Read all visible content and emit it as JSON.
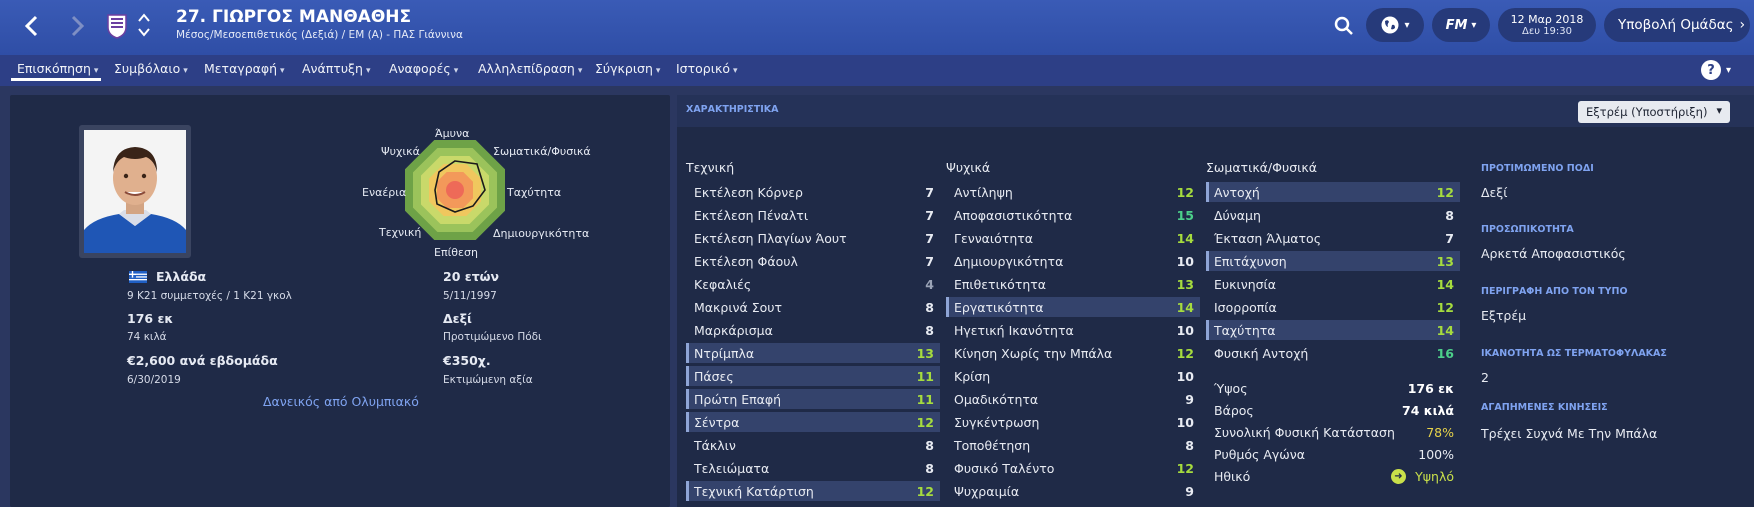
{
  "header": {
    "title": "27. ΓΙΩΡΓΟΣ ΜΑΝΘΑΘΗΣ",
    "subtitle": "Μέσος/Μεσοεπιθετικός (Δεξιά) / ΕΜ (Α) - ΠΑΣ Γιάννινα",
    "date": "12 Μαρ 2018",
    "time": "Δευ 19:30",
    "submit_label": "Υποβολή Ομάδας",
    "fm_label": "FM"
  },
  "nav": {
    "tabs": [
      "Επισκόπηση",
      "Συμβόλαιο",
      "Μεταγραφή",
      "Ανάπτυξη",
      "Αναφορές",
      "Αλληλεπίδραση",
      "Σύγκριση",
      "Ιστορικό"
    ]
  },
  "overview": {
    "nationality": "Ελλάδα",
    "caps": "9 K21 συμμετοχές / 1 K21 γκολ",
    "height": "176 εκ",
    "weight": "74 κιλά",
    "wage": "€2,600 ανά εβδομάδα",
    "contract_end": "6/30/2019",
    "age": "20 ετών",
    "dob": "5/11/1997",
    "foot": "Δεξί",
    "foot_label": "Προτιμώμενο Πόδι",
    "value": "€350χ.",
    "value_label": "Εκτιμώμενη αξία",
    "loan_note": "Δανεικός από Ολυμπιακό"
  },
  "radar": {
    "labels": {
      "defence": "Άμυνα",
      "physical": "Σωματικά/Φυσικά",
      "speed": "Ταχύτητα",
      "creativity": "Δημιουργικότητα",
      "attack": "Επίθεση",
      "technique": "Τεχνική",
      "aerial": "Εναέρια",
      "mental": "Ψυχικά"
    }
  },
  "attributes": {
    "section_title": "ΧΑΡΑΚΤΗΡΙΣΤΙΚΑ",
    "dropdown_label": "Εξτρέμ (Υποστήριξη)",
    "technical": {
      "title": "Τεχνική",
      "items": [
        {
          "name": "Εκτέλεση Κόρνερ",
          "value": "7",
          "color": "#e8ebf2",
          "hl": false
        },
        {
          "name": "Εκτέλεση Πέναλτι",
          "value": "7",
          "color": "#e8ebf2",
          "hl": false
        },
        {
          "name": "Εκτέλεση Πλαγίων Άουτ",
          "value": "7",
          "color": "#e8ebf2",
          "hl": false
        },
        {
          "name": "Εκτέλεση Φάουλ",
          "value": "7",
          "color": "#e8ebf2",
          "hl": false
        },
        {
          "name": "Κεφαλιές",
          "value": "4",
          "color": "#9aa3b6",
          "hl": false
        },
        {
          "name": "Μακρινά Σουτ",
          "value": "8",
          "color": "#e8ebf2",
          "hl": false
        },
        {
          "name": "Μαρκάρισμα",
          "value": "8",
          "color": "#e8ebf2",
          "hl": false
        },
        {
          "name": "Ντρίμπλα",
          "value": "13",
          "color": "#a6dc3e",
          "hl": true
        },
        {
          "name": "Πάσες",
          "value": "11",
          "color": "#a6dc3e",
          "hl": true
        },
        {
          "name": "Πρώτη Επαφή",
          "value": "11",
          "color": "#a6dc3e",
          "hl": true
        },
        {
          "name": "Σέντρα",
          "value": "12",
          "color": "#a6dc3e",
          "hl": true
        },
        {
          "name": "Τάκλιν",
          "value": "8",
          "color": "#e8ebf2",
          "hl": false
        },
        {
          "name": "Τελειώματα",
          "value": "8",
          "color": "#e8ebf2",
          "hl": false
        },
        {
          "name": "Τεχνική Κατάρτιση",
          "value": "12",
          "color": "#a6dc3e",
          "hl": true
        }
      ]
    },
    "mental": {
      "title": "Ψυχικά",
      "items": [
        {
          "name": "Αντίληψη",
          "value": "12",
          "color": "#a6dc3e",
          "hl": false
        },
        {
          "name": "Αποφασιστικότητα",
          "value": "15",
          "color": "#4cd08a",
          "hl": false
        },
        {
          "name": "Γενναιότητα",
          "value": "14",
          "color": "#a6dc3e",
          "hl": false
        },
        {
          "name": "Δημιουργικότητα",
          "value": "10",
          "color": "#e8ebf2",
          "hl": false
        },
        {
          "name": "Επιθετικότητα",
          "value": "13",
          "color": "#a6dc3e",
          "hl": false
        },
        {
          "name": "Εργατικότητα",
          "value": "14",
          "color": "#a6dc3e",
          "hl": true
        },
        {
          "name": "Ηγετική Ικανότητα",
          "value": "10",
          "color": "#e8ebf2",
          "hl": false
        },
        {
          "name": "Κίνηση Χωρίς την Μπάλα",
          "value": "12",
          "color": "#a6dc3e",
          "hl": false
        },
        {
          "name": "Κρίση",
          "value": "10",
          "color": "#e8ebf2",
          "hl": false
        },
        {
          "name": "Ομαδικότητα",
          "value": "9",
          "color": "#e8ebf2",
          "hl": false
        },
        {
          "name": "Συγκέντρωση",
          "value": "10",
          "color": "#e8ebf2",
          "hl": false
        },
        {
          "name": "Τοποθέτηση",
          "value": "8",
          "color": "#e8ebf2",
          "hl": false
        },
        {
          "name": "Φυσικό Ταλέντο",
          "value": "12",
          "color": "#a6dc3e",
          "hl": false
        },
        {
          "name": "Ψυχραιμία",
          "value": "9",
          "color": "#e8ebf2",
          "hl": false
        }
      ]
    },
    "physical": {
      "title": "Σωματικά/Φυσικά",
      "items": [
        {
          "name": "Αντοχή",
          "value": "12",
          "color": "#a6dc3e",
          "hl": true
        },
        {
          "name": "Δύναμη",
          "value": "8",
          "color": "#e8ebf2",
          "hl": false
        },
        {
          "name": "Έκταση Άλματος",
          "value": "7",
          "color": "#e8ebf2",
          "hl": false
        },
        {
          "name": "Επιτάχυνση",
          "value": "13",
          "color": "#a6dc3e",
          "hl": true
        },
        {
          "name": "Ευκινησία",
          "value": "14",
          "color": "#a6dc3e",
          "hl": false
        },
        {
          "name": "Ισορροπία",
          "value": "12",
          "color": "#a6dc3e",
          "hl": false
        },
        {
          "name": "Ταχύτητα",
          "value": "14",
          "color": "#a6dc3e",
          "hl": true
        },
        {
          "name": "Φυσική Αντοχή",
          "value": "16",
          "color": "#4cd08a",
          "hl": false
        }
      ]
    },
    "stats": [
      {
        "name": "Ύψος",
        "value": "176 εκ",
        "color": "#ffffff"
      },
      {
        "name": "Βάρος",
        "value": "74 κιλά",
        "color": "#ffffff"
      },
      {
        "name": "Συνολική Φυσική Κατάσταση",
        "value": "78%",
        "color": "#e6d24a"
      },
      {
        "name": "Ρυθμός Αγώνα",
        "value": "100%",
        "color": "#e8ebf2"
      },
      {
        "name": "Ηθικό",
        "value": "Υψηλό",
        "color": "#c9e04a"
      }
    ]
  },
  "side": {
    "foot_head": "ΠΡΟΤΙΜΩΜΕΝΟ ΠΟΔΙ",
    "foot_val": "Δεξί",
    "personality_head": "ΠΡΟΣΩΠΙΚΟΤΗΤΑ",
    "personality_val": "Αρκετά Αποφασιστικός",
    "type_head": "ΠΕΡΙΓΡΑΦΗ ΑΠΟ ΤΟΝ ΤΥΠΟ",
    "type_val": "Εξτρέμ",
    "gk_head": "ΙΚΑΝΟΤΗΤΑ ΩΣ ΤΕΡΜΑΤΟΦΥΛΑΚΑΣ",
    "gk_val": "2",
    "moves_head": "ΑΓΑΠΗΜΕΝΕΣ ΚΙΝΗΣΕΙΣ",
    "moves_val": "Τρέχει Συχνά Με Την Μπάλα"
  },
  "colors": {
    "accent_blue": "#7fa3f0",
    "good": "#a6dc3e",
    "very_good": "#4cd08a"
  }
}
